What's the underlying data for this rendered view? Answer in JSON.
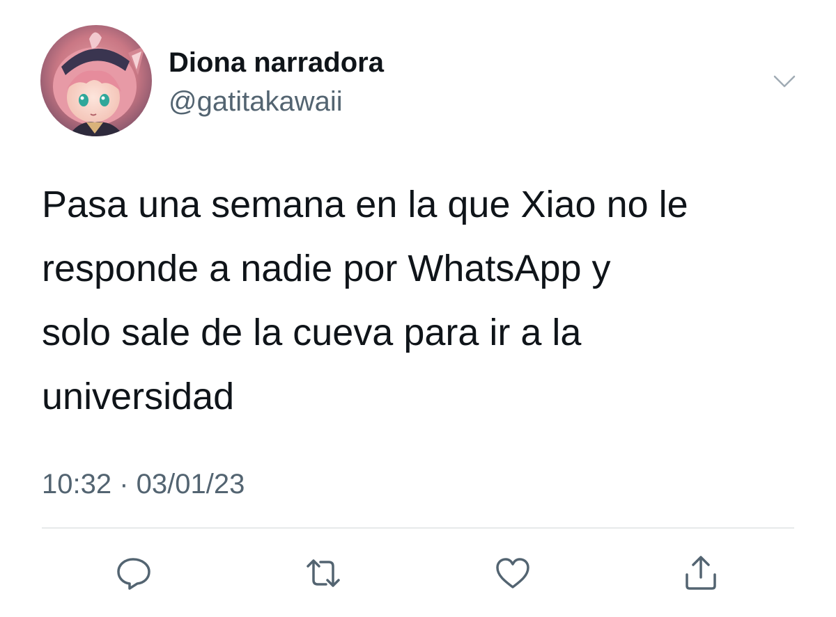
{
  "author": {
    "display_name": "Diona narradora",
    "handle": "@gatitakawaii",
    "avatar_icon": "profile-avatar"
  },
  "tweet": {
    "lines": [
      "Pasa una semana en la que Xiao no le",
      "responde a nadie por WhatsApp y",
      "solo sale de la cueva para ir a la",
      "universidad"
    ]
  },
  "meta": {
    "timestamp": "10:32 · 03/01/23"
  },
  "actions": {
    "reply_icon": "reply-icon",
    "retweet_icon": "retweet-icon",
    "like_icon": "heart-icon",
    "share_icon": "share-icon"
  },
  "colors": {
    "text_primary": "#0f1419",
    "text_secondary": "#536471",
    "divider": "#e7e9ea"
  }
}
